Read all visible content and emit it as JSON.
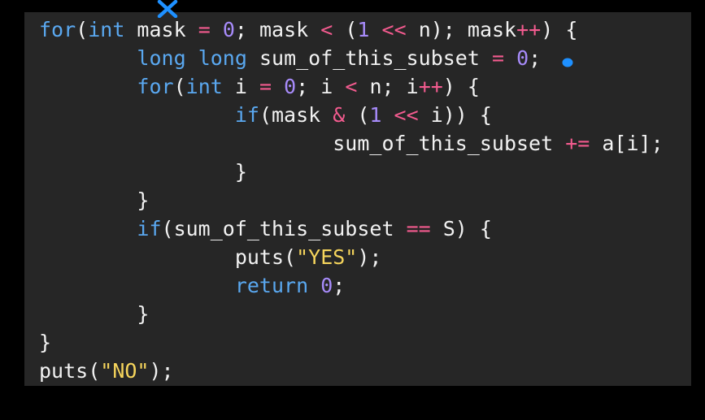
{
  "colors": {
    "background": "#000000",
    "editor_bg": "#262626",
    "keyword": "#5aa8f0",
    "operator": "#f35b8f",
    "number": "#a78bfa",
    "string": "#f6d55c",
    "text": "#f2f2f2",
    "annotation": "#1e90ff"
  },
  "annotations": {
    "cross_icon": "x-mark-icon",
    "dot_icon": "ink-dot-icon"
  },
  "code_lines": [
    {
      "indent": "",
      "tokens": [
        {
          "t": "for",
          "c": "kw"
        },
        {
          "t": "(",
          "c": "pun"
        },
        {
          "t": "int",
          "c": "kw"
        },
        {
          "t": " mask ",
          "c": "id"
        },
        {
          "t": "=",
          "c": "op"
        },
        {
          "t": " ",
          "c": "id"
        },
        {
          "t": "0",
          "c": "num"
        },
        {
          "t": "; mask ",
          "c": "id"
        },
        {
          "t": "<",
          "c": "op"
        },
        {
          "t": " (",
          "c": "pun"
        },
        {
          "t": "1",
          "c": "num"
        },
        {
          "t": " ",
          "c": "id"
        },
        {
          "t": "<<",
          "c": "op"
        },
        {
          "t": " n); mask",
          "c": "id"
        },
        {
          "t": "++",
          "c": "op"
        },
        {
          "t": ") {",
          "c": "pun"
        }
      ]
    },
    {
      "indent": "        ",
      "tokens": [
        {
          "t": "long",
          "c": "kw"
        },
        {
          "t": " ",
          "c": "id"
        },
        {
          "t": "long",
          "c": "kw"
        },
        {
          "t": " sum_of_this_subset ",
          "c": "id"
        },
        {
          "t": "=",
          "c": "op"
        },
        {
          "t": " ",
          "c": "id"
        },
        {
          "t": "0",
          "c": "num"
        },
        {
          "t": ";",
          "c": "pun"
        }
      ]
    },
    {
      "indent": "        ",
      "tokens": [
        {
          "t": "for",
          "c": "kw"
        },
        {
          "t": "(",
          "c": "pun"
        },
        {
          "t": "int",
          "c": "kw"
        },
        {
          "t": " i ",
          "c": "id"
        },
        {
          "t": "=",
          "c": "op"
        },
        {
          "t": " ",
          "c": "id"
        },
        {
          "t": "0",
          "c": "num"
        },
        {
          "t": "; i ",
          "c": "id"
        },
        {
          "t": "<",
          "c": "op"
        },
        {
          "t": " n; i",
          "c": "id"
        },
        {
          "t": "++",
          "c": "op"
        },
        {
          "t": ") {",
          "c": "pun"
        }
      ]
    },
    {
      "indent": "                ",
      "tokens": [
        {
          "t": "if",
          "c": "kw"
        },
        {
          "t": "(mask ",
          "c": "id"
        },
        {
          "t": "&",
          "c": "op"
        },
        {
          "t": " (",
          "c": "pun"
        },
        {
          "t": "1",
          "c": "num"
        },
        {
          "t": " ",
          "c": "id"
        },
        {
          "t": "<<",
          "c": "op"
        },
        {
          "t": " i)) {",
          "c": "id"
        }
      ]
    },
    {
      "indent": "                        ",
      "tokens": [
        {
          "t": "sum_of_this_subset ",
          "c": "id"
        },
        {
          "t": "+=",
          "c": "op"
        },
        {
          "t": " a[i];",
          "c": "id"
        }
      ]
    },
    {
      "indent": "                ",
      "tokens": [
        {
          "t": "}",
          "c": "pun"
        }
      ]
    },
    {
      "indent": "        ",
      "tokens": [
        {
          "t": "}",
          "c": "pun"
        }
      ]
    },
    {
      "indent": "        ",
      "tokens": [
        {
          "t": "if",
          "c": "kw"
        },
        {
          "t": "(sum_of_this_subset ",
          "c": "id"
        },
        {
          "t": "==",
          "c": "op"
        },
        {
          "t": " S) {",
          "c": "id"
        }
      ]
    },
    {
      "indent": "                ",
      "tokens": [
        {
          "t": "puts(",
          "c": "id"
        },
        {
          "t": "\"YES\"",
          "c": "str"
        },
        {
          "t": ");",
          "c": "pun"
        }
      ]
    },
    {
      "indent": "                ",
      "tokens": [
        {
          "t": "return",
          "c": "kw"
        },
        {
          "t": " ",
          "c": "id"
        },
        {
          "t": "0",
          "c": "num"
        },
        {
          "t": ";",
          "c": "pun"
        }
      ]
    },
    {
      "indent": "        ",
      "tokens": [
        {
          "t": "}",
          "c": "pun"
        }
      ]
    },
    {
      "indent": "",
      "tokens": [
        {
          "t": "}",
          "c": "pun"
        }
      ]
    },
    {
      "indent": "",
      "tokens": [
        {
          "t": "puts(",
          "c": "id"
        },
        {
          "t": "\"NO\"",
          "c": "str"
        },
        {
          "t": ");",
          "c": "pun"
        }
      ]
    }
  ]
}
